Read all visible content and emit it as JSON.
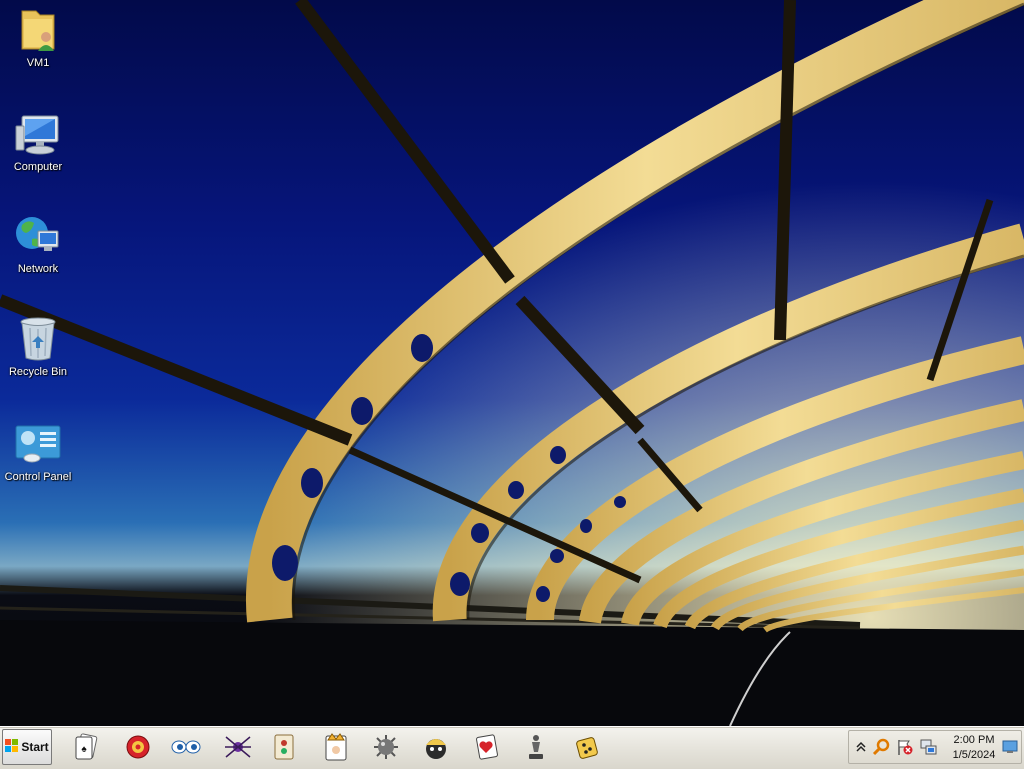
{
  "desktop": {
    "icons": [
      {
        "label": "VM1",
        "icon": "user-folder-icon"
      },
      {
        "label": "Computer",
        "icon": "computer-icon"
      },
      {
        "label": "Network",
        "icon": "network-icon"
      },
      {
        "label": "Recycle Bin",
        "icon": "recycle-bin-icon"
      },
      {
        "label": "Control Panel",
        "icon": "control-panel-icon"
      }
    ]
  },
  "taskbar": {
    "start_label": "Start",
    "quick_launch": [
      {
        "icon": "solitaire-icon"
      },
      {
        "icon": "pinball-icon"
      },
      {
        "icon": "eyes-icon"
      },
      {
        "icon": "spider-solitaire-icon"
      },
      {
        "icon": "mahjong-icon"
      },
      {
        "icon": "hearts-icon"
      },
      {
        "icon": "minesweeper-icon"
      },
      {
        "icon": "purble-place-icon"
      },
      {
        "icon": "freecell-icon"
      },
      {
        "icon": "chess-icon"
      },
      {
        "icon": "dice-game-icon"
      }
    ],
    "tray": {
      "icons": [
        "show-hidden-icons-chevron-icon",
        "search-icon",
        "action-center-flag-icon",
        "network-status-icon",
        "show-desktop-icon"
      ],
      "time": "2:00 PM",
      "date": "1/5/2024"
    }
  },
  "colors": {
    "sky_top": "#020a4a",
    "sky_mid": "#0b2a9a",
    "bridge_gold": "#e8c872",
    "taskbar": "#e6e4dc"
  }
}
